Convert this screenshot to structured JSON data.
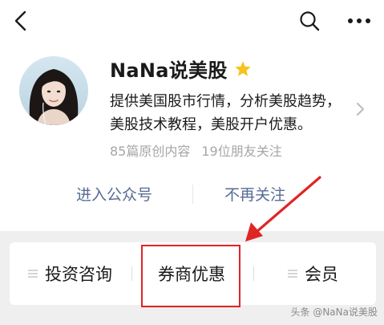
{
  "nav": {
    "back_icon": "chevron-left-icon",
    "search_icon": "search-icon",
    "more_icon": "more-horizontal-icon"
  },
  "profile": {
    "name": "NaNa说美股",
    "verified_icon": "star-icon",
    "verified_color": "#f7c21c",
    "description": "提供美国股市行情，分析美股趋势，美股技术教程，美股开户优惠。",
    "stats": {
      "articles": "85篇原创内容",
      "friends": "19位朋友关注"
    }
  },
  "actions": {
    "enter": "进入公众号",
    "unfollow": "不再关注",
    "link_color": "#576b95"
  },
  "menu": {
    "items": [
      {
        "label": "投资咨询",
        "icon": "menu-lines-icon"
      },
      {
        "label": "券商优惠",
        "icon": ""
      },
      {
        "label": "会员",
        "icon": "menu-lines-icon"
      }
    ]
  },
  "annotation": {
    "highlight_color": "#e02525",
    "highlighted_item": "券商优惠"
  },
  "watermark": {
    "text": "头条 @NaNa说美股"
  }
}
